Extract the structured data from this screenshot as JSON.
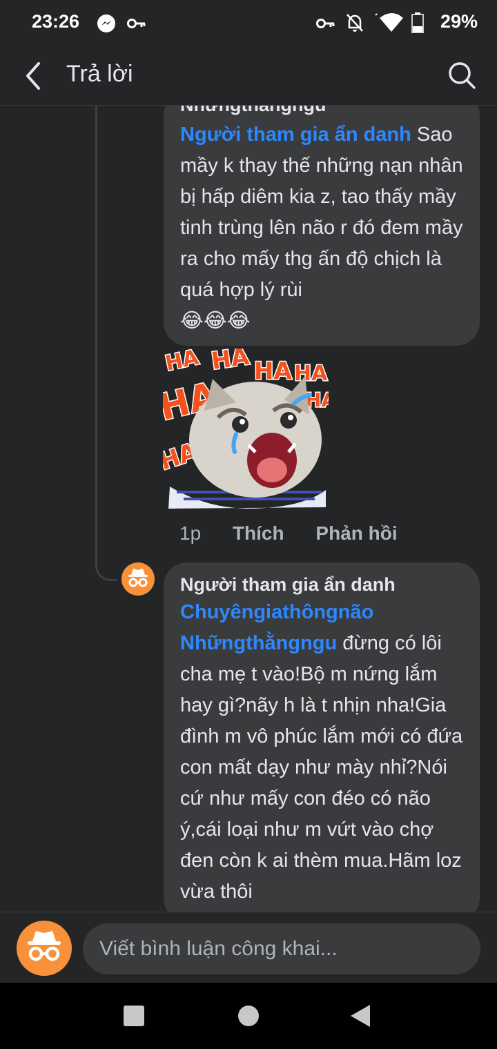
{
  "status_bar": {
    "time": "23:26",
    "battery": "29%",
    "icons": [
      "messenger-icon",
      "key-icon",
      "vpn-key-icon",
      "notifications-off-icon",
      "wifi-icon",
      "battery-icon"
    ]
  },
  "header": {
    "title": "Trả lời",
    "back_icon": "back-arrow-icon",
    "search_icon": "search-icon"
  },
  "comments": [
    {
      "author_partial": "Nhữngthằngngu",
      "mention": "Người tham gia ẩn danh",
      "text": "Sao mầy k thay thế những nạn nhân bị hấp diêm kia z, tao thấy mầy tinh trùng lên não r đó đem mầy ra cho mấy thg ấn độ chịch là quá hợp lý rùi",
      "emoji": "😂😂😂",
      "sticker_text": [
        "HA",
        "HA",
        "HA",
        "HA",
        "HA",
        "HA",
        "HA"
      ],
      "meta": {
        "time": "1p",
        "like": "Thích",
        "reply": "Phản hồi"
      }
    },
    {
      "author": "Người tham gia ẩn danh",
      "mention_line1": "Chuyêngiathôngnão",
      "mention_line2": "Nhữngthằngngu",
      "text": "đừng có lôi cha mẹ t vào!Bộ m nứng lắm hay gì?nãy h là t nhịn nha!Gia đình m vô phúc lắm mới có đứa con mất dạy như mày nhỉ?Nói cứ như mấy con đéo có não ý,cái loại như m vứt vào chợ đen còn k ai thèm mua.Hãm loz vừa thôi"
    }
  ],
  "composer": {
    "placeholder": "Viết bình luận công khai..."
  },
  "colors": {
    "background": "#242526",
    "bubble": "#3a3b3c",
    "mention": "#2d88ff",
    "anon_avatar": "#f7923a"
  }
}
